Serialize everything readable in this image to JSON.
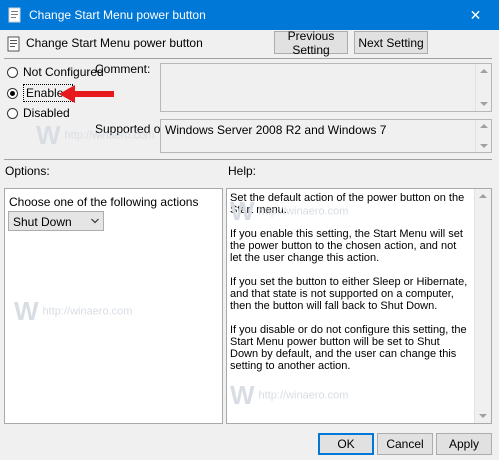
{
  "window": {
    "title": "Change Start Menu power button",
    "close_glyph": "✕"
  },
  "header": {
    "policy_title": "Change Start Menu power button",
    "prev_label": "Previous Setting",
    "next_label": "Next Setting"
  },
  "state": {
    "options": [
      {
        "label": "Not Configured",
        "selected": false
      },
      {
        "label": "Enabled",
        "selected": true
      },
      {
        "label": "Disabled",
        "selected": false
      }
    ]
  },
  "comment": {
    "label": "Comment:",
    "value": ""
  },
  "supported": {
    "label": "Supported on:",
    "value": "Windows Server 2008 R2 and Windows 7"
  },
  "options_pane": {
    "label": "Options:",
    "instruction": "Choose one of the following actions",
    "dropdown_value": "Shut Down"
  },
  "help_pane": {
    "label": "Help:",
    "paragraphs": [
      "Set the default action of the power button on the Start menu.",
      "If you enable this setting, the Start Menu will set the power button to the chosen action, and not let the user change this action.",
      "If you set the button to either Sleep or Hibernate, and that state is not supported on a computer, then the button will fall back to Shut Down.",
      "If you disable or do not configure this setting, the Start Menu power button will be set to Shut Down by default, and the user can change this setting to another action."
    ]
  },
  "footer": {
    "ok_label": "OK",
    "cancel_label": "Cancel",
    "apply_label": "Apply"
  },
  "watermark": {
    "letter": "W",
    "text": "http://winaero.com"
  },
  "colors": {
    "titlebar": "#0078d7",
    "arrow": "#e8191c",
    "window_bg": "#f0f0f0"
  }
}
